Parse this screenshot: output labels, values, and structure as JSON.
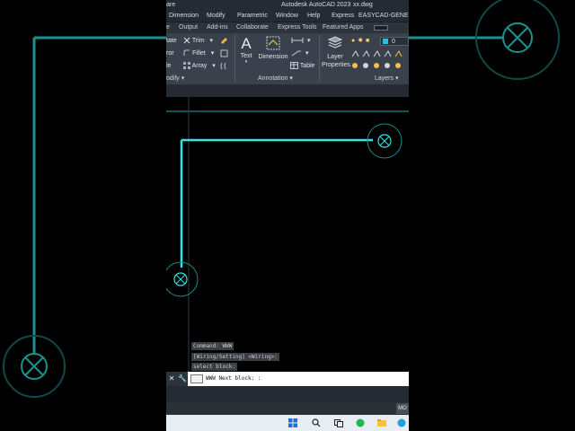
{
  "window": {
    "title_left_fragment": "are",
    "app_title": "Autodesk AutoCAD 2023",
    "file_name": "xx.dwg"
  },
  "menu": {
    "items": [
      "Dimension",
      "Modify",
      "Parametric",
      "Window",
      "Help",
      "Express",
      "EASYCAD-GEN",
      "E"
    ]
  },
  "tabs": {
    "items": [
      "e",
      "Output",
      "Add-ins",
      "Collaborate",
      "Express Tools",
      "Featured Apps"
    ]
  },
  "ribbon": {
    "modify_panel": {
      "label": "odify",
      "rotate_label": "tate",
      "trim_label": "Trim",
      "mirror_label": "ror",
      "fillet_label": "Fillet",
      "scale_label": "le",
      "array_label": "Array"
    },
    "annotation_panel": {
      "label": "Annotation",
      "text_label": "Text",
      "dimension_label": "Dimension",
      "table_label": "Table"
    },
    "layers_panel": {
      "label": "Layers",
      "layer_properties_label": "Layer\nProperties",
      "layer_properties_line1": "Layer",
      "layer_properties_line2": "Properties",
      "current_layer": "0",
      "current_layer_color": "#26c6da"
    }
  },
  "command_history": [
    "Command: WWW",
    "[Wiring/Setting] <Wiring>:",
    "select block:"
  ],
  "command_line": {
    "prompt": "WWW Next block: :"
  },
  "status": {
    "model_label": "MO"
  },
  "colors": {
    "wire": "#2ee6e6",
    "canvas_bg": "#000000",
    "ribbon_bg": "#3a414c"
  }
}
